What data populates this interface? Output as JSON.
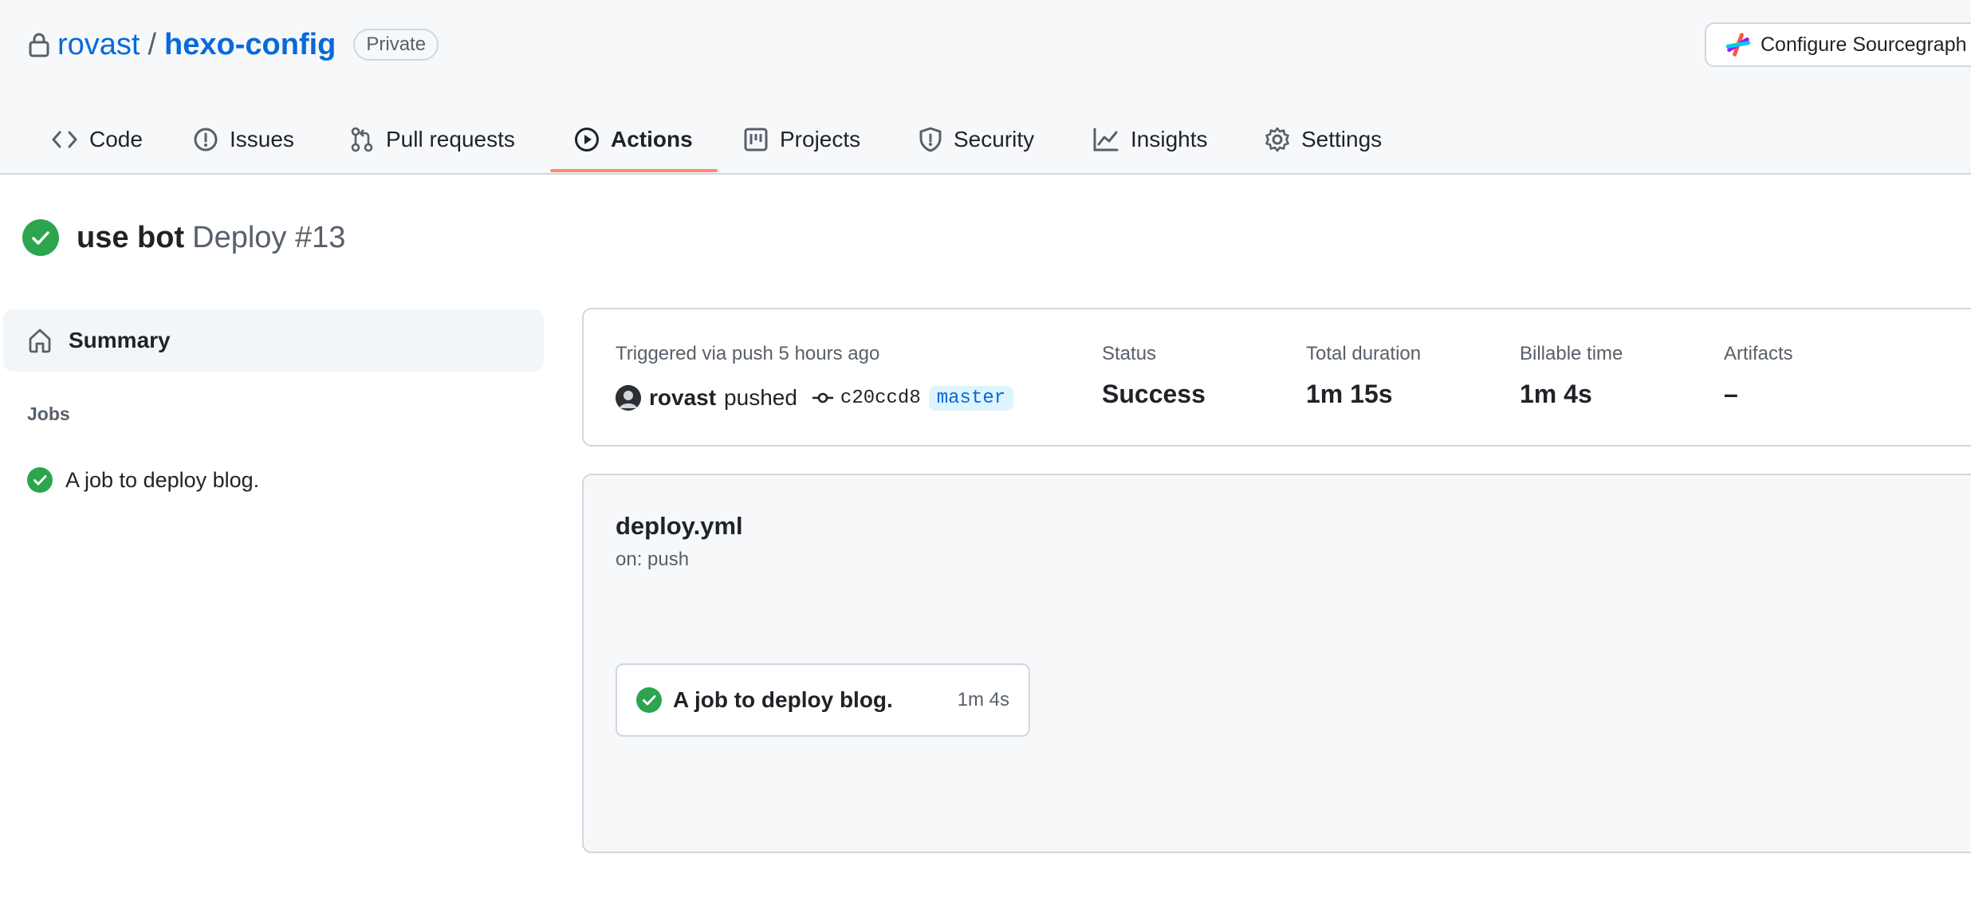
{
  "repo": {
    "owner": "rovast",
    "separator": "/",
    "name": "hexo-config",
    "visibility": "Private"
  },
  "header_button": {
    "label": "Configure Sourcegraph",
    "icon": "sourcegraph-logo-icon"
  },
  "tabs": [
    {
      "label": "Code",
      "icon": "code-icon"
    },
    {
      "label": "Issues",
      "icon": "issue-icon"
    },
    {
      "label": "Pull requests",
      "icon": "pull-request-icon"
    },
    {
      "label": "Actions",
      "icon": "play-icon",
      "active": true
    },
    {
      "label": "Projects",
      "icon": "project-icon"
    },
    {
      "label": "Security",
      "icon": "shield-icon"
    },
    {
      "label": "Insights",
      "icon": "graph-icon"
    },
    {
      "label": "Settings",
      "icon": "gear-icon"
    }
  ],
  "run": {
    "commit_message": "use bot",
    "workflow_label": "Deploy #13",
    "status_icon": "check-circle-icon"
  },
  "sidebar": {
    "summary_label": "Summary",
    "jobs_heading": "Jobs",
    "jobs": [
      {
        "label": "A job to deploy blog."
      }
    ]
  },
  "summary": {
    "triggered": "Triggered via push 5 hours ago",
    "actor": "rovast",
    "action": "pushed",
    "sha": "c20ccd8",
    "branch": "master",
    "status_label": "Status",
    "status_value": "Success",
    "duration_label": "Total duration",
    "duration_value": "1m 15s",
    "billable_label": "Billable time",
    "billable_value": "1m 4s",
    "artifacts_label": "Artifacts",
    "artifacts_value": "–"
  },
  "workflow": {
    "file": "deploy.yml",
    "trigger": "on: push",
    "job": {
      "label": "A job to deploy blog.",
      "duration": "1m 4s"
    }
  },
  "colors": {
    "accent_link": "#0969da",
    "success": "#2da44e",
    "tab_underline": "#fd8c73"
  }
}
